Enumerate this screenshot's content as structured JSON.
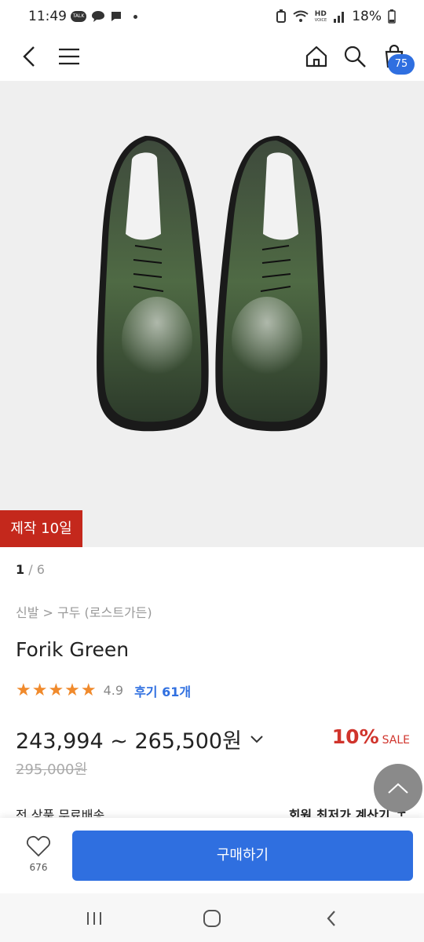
{
  "status_bar": {
    "time": "11:49",
    "notif_talk": "TALK",
    "network": "HD",
    "network_sub": "VOICE",
    "battery": "18%"
  },
  "nav": {
    "cart_count": "75"
  },
  "product": {
    "made_badge": "제작 10일",
    "pager_current": "1",
    "pager_total": "/ 6",
    "breadcrumb": "신발 > 구두 (로스트가든)",
    "name": "Forik Green",
    "stars": "★★★★★",
    "rating": "4.9",
    "reviews": "후기 61개",
    "price_range": "243,994 ~ 265,500원",
    "discount_pct": "10%",
    "discount_label": "SALE",
    "original_price": "295,000원",
    "shipping": "전 상품 무료배송",
    "member_price": "회원 최저가 계산기",
    "member_plus": "+"
  },
  "bottom": {
    "like_count": "676",
    "buy_label": "구매하기"
  },
  "colors": {
    "accent": "#2f6fe0",
    "badge_red": "#c4281c",
    "sale_red": "#d0342c",
    "star": "#f08a2c"
  }
}
